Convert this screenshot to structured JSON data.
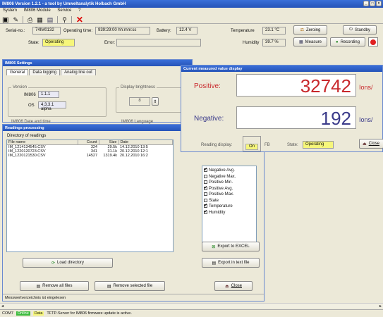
{
  "app": {
    "title": "IM806 Version 1.2.1 - a tool by Umweltanalytik Holbach GmbH",
    "menu": [
      "System",
      "IM806 Module",
      "Service",
      "?"
    ]
  },
  "header": {
    "serial_label": "Serial-no.:",
    "serial_value": "74IM0132",
    "op_time_label": "Operating time:",
    "op_time_value": "939:29:00 hh:mm:ss",
    "battery_label": "Battery:",
    "battery_value": "12.4 V",
    "temperature_label": "Temperature",
    "temperature_value": "23.1 °C",
    "state_label": "State:",
    "state_value": "Operating",
    "error_label": "Error:",
    "error_value": "",
    "humidity_label": "Humidity",
    "humidity_value": "39.7 %",
    "zeroing_label": "Zeroing",
    "standby_label": "Standby",
    "measure_label": "Measure",
    "recording_label": "Recording"
  },
  "settings": {
    "title": "IM806 Settings",
    "tabs": [
      "General",
      "Data logging",
      "Analog line out"
    ],
    "version_group": "Version",
    "im806_label": "IM806",
    "im806_value": "1.1.1",
    "os_label": "OS",
    "os_value": "4.3.3.1 alpha",
    "brightness_group": "Display brightness",
    "brightness_value": "8",
    "datetime_group": "IM806 Date and time",
    "language_group": "IM806 Language"
  },
  "readings": {
    "title": "Readings processing",
    "dir_label": "Directory of readings",
    "columns": [
      "File name",
      "Count",
      "Size",
      "Date"
    ],
    "rows": [
      [
        "IM_1214134545.CSV",
        "324",
        "29.5k",
        "14.12.2010 13:5"
      ],
      [
        "IM_1220120723.CSV",
        "341",
        "31.1k",
        "20.12.2010 12:1"
      ],
      [
        "IM_1220121530.CSV",
        "14527",
        "1319.4k",
        "20.12.2010 16:2"
      ]
    ],
    "checkboxes": [
      {
        "label": "Negative Avg.",
        "checked": true
      },
      {
        "label": "Negative Max.",
        "checked": false
      },
      {
        "label": "Positive Min.",
        "checked": false
      },
      {
        "label": "Positive Avg.",
        "checked": true
      },
      {
        "label": "Positive Max.",
        "checked": false
      },
      {
        "label": "State",
        "checked": false
      },
      {
        "label": "Temperature",
        "checked": true
      },
      {
        "label": "Humidity",
        "checked": true
      }
    ],
    "load_dir": "Load directory",
    "export_excel": "Export to EXCEL",
    "export_text": "Export in text file",
    "remove_all": "Remove all files",
    "remove_selected": "Remove selected file",
    "close": "Close",
    "status": "Messwertverzeichnis ist eingelesen"
  },
  "measured": {
    "title": "Current measured value display",
    "positive_label": "Positive:",
    "positive_value": "32742",
    "positive_unit": "Ions/",
    "negative_label": "Negative:",
    "negative_value": "192",
    "negative_unit": "Ions/",
    "reading_display_label": "Reading display:",
    "on_label": "On",
    "fb_label": "FB",
    "state_label": "State:",
    "state_value": "Operating",
    "close": "Close"
  },
  "statusbar": {
    "left": "COM7",
    "online": "Online",
    "data": "Data",
    "message": "TFTP-Server for IM806 firmware update is active."
  },
  "colors": {
    "positive": "#c8282c",
    "negative": "#3a3a8a",
    "state": "#f6f67a",
    "online": "#3dbb3d"
  }
}
